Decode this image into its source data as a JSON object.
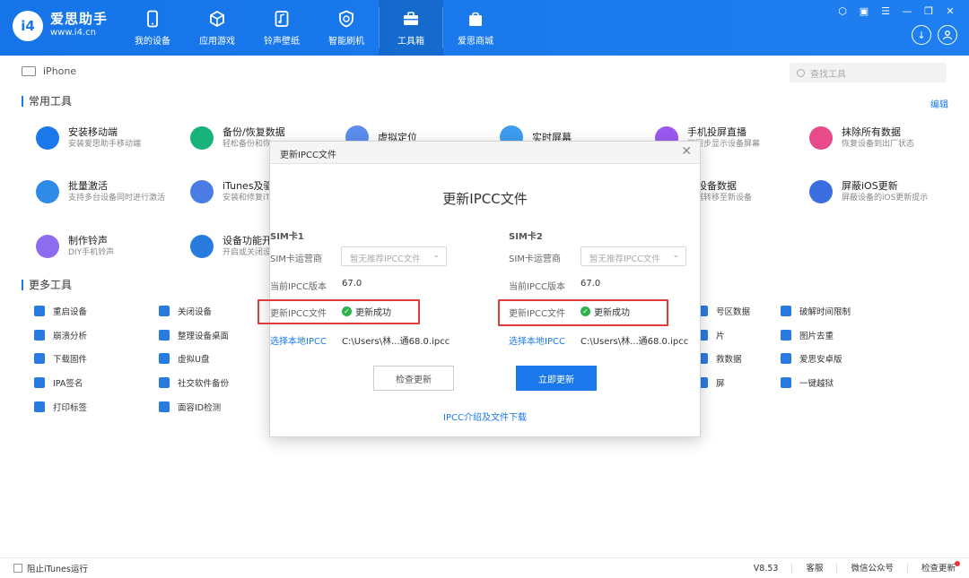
{
  "app": {
    "name": "爱思助手",
    "url": "www.i4.cn",
    "badge": "i4"
  },
  "nav": [
    {
      "label": "我的设备",
      "icon": "phone-icon"
    },
    {
      "label": "应用游戏",
      "icon": "cube-icon"
    },
    {
      "label": "铃声壁纸",
      "icon": "music-file-icon"
    },
    {
      "label": "智能刷机",
      "icon": "refresh-shield-icon"
    },
    {
      "label": "工具箱",
      "icon": "toolbox-icon",
      "active": true
    },
    {
      "label": "爱思商城",
      "icon": "shopping-bag-icon"
    }
  ],
  "device": {
    "name": "iPhone"
  },
  "search": {
    "placeholder": "查找工具"
  },
  "common": {
    "title": "常用工具",
    "edit": "编辑",
    "tools": [
      {
        "title": "安装移动端",
        "desc": "安装爱思助手移动端",
        "color": "#1a78ea",
        "icon": "i4-app-icon"
      },
      {
        "title": "备份/恢复数据",
        "desc": "轻松备份和恢",
        "color": "#18b37a",
        "icon": "layers-icon"
      },
      {
        "title": "虚拟定位",
        "desc": "",
        "color": "#5b8def",
        "icon": "location-pin-icon"
      },
      {
        "title": "实时屏幕",
        "desc": "",
        "color": "#3d9cf0",
        "icon": "screen-icon"
      },
      {
        "title": "手机投屏直播",
        "desc": "画同步显示设备屏幕",
        "color": "#9b59f0",
        "icon": "play-screen-icon"
      },
      {
        "title": "抹除所有数据",
        "desc": "恢复设备到出厂状态",
        "color": "#e84b8a",
        "icon": "eraser-icon"
      },
      {
        "title": "批量激活",
        "desc": "支持多台设备同时进行激活",
        "color": "#2f8be8",
        "icon": "batch-activate-icon"
      },
      {
        "title": "iTunes及驱",
        "desc": "安装和修复iT",
        "color": "#4a7ce6",
        "icon": "music-note-icon"
      },
      {
        "title": "移设备数据",
        "desc": "数据转移至新设备",
        "color": "#3a8ee6",
        "icon": "transfer-icon"
      },
      {
        "title": "屏蔽iOS更新",
        "desc": "屏蔽设备的iOS更新提示",
        "color": "#3b6fe0",
        "icon": "block-update-icon"
      },
      {
        "title": "制作铃声",
        "desc": "DIY手机铃声",
        "color": "#8e6cf0",
        "icon": "ringtone-icon"
      },
      {
        "title": "设备功能开",
        "desc": "开启或关闭设",
        "color": "#2a7be0",
        "icon": "sliders-icon"
      }
    ]
  },
  "more": {
    "title": "更多工具",
    "tools": [
      {
        "label": "重启设备",
        "icon": "restart-icon"
      },
      {
        "label": "关闭设备",
        "icon": "power-icon"
      },
      {
        "label": "号区数据",
        "icon": "data-icon"
      },
      {
        "label": "破解时间限制",
        "icon": "clock-icon"
      },
      {
        "label": "崩溃分析",
        "icon": "crash-analysis-icon"
      },
      {
        "label": "整理设备桌面",
        "icon": "grid-icon"
      },
      {
        "label": "片",
        "icon": "image-icon"
      },
      {
        "label": "图片去重",
        "icon": "image-dedupe-icon"
      },
      {
        "label": "下载固件",
        "icon": "download-firmware-icon"
      },
      {
        "label": "虚拟U盘",
        "icon": "usb-drive-icon"
      },
      {
        "label": "救数据",
        "icon": "rescue-data-icon"
      },
      {
        "label": "爱思安卓版",
        "icon": "android-icon"
      },
      {
        "label": "IPA签名",
        "icon": "ipa-icon"
      },
      {
        "label": "社交软件备份",
        "icon": "social-backup-icon"
      },
      {
        "label": "屏",
        "icon": "screen-icon"
      },
      {
        "label": "一键越狱",
        "icon": "lock-icon"
      },
      {
        "label": "打印标签",
        "icon": "printer-icon"
      },
      {
        "label": "面容ID检测",
        "icon": "face-id-icon"
      }
    ]
  },
  "modal": {
    "header": "更新IPCC文件",
    "title": "更新IPCC文件",
    "sim1": {
      "label": "SIM卡1",
      "carrier_label": "SIM卡运营商",
      "carrier_placeholder": "暂无推荐IPCC文件",
      "version_label": "当前IPCC版本",
      "version": "67.0",
      "file_label": "更新IPCC文件",
      "status": "更新成功",
      "choose_label": "选择本地IPCC",
      "path": "C:\\Users\\林...通68.0.ipcc"
    },
    "sim2": {
      "label": "SIM卡2",
      "carrier_label": "SIM卡运营商",
      "carrier_placeholder": "暂无推荐IPCC文件",
      "version_label": "当前IPCC版本",
      "version": "67.0",
      "file_label": "更新IPCC文件",
      "status": "更新成功",
      "choose_label": "选择本地IPCC",
      "path": "C:\\Users\\林...通68.0.ipcc"
    },
    "check_button": "检查更新",
    "update_button": "立即更新",
    "intro_link": "IPCC介绍及文件下载"
  },
  "bottom": {
    "block_itunes": "阻止iTunes运行",
    "version": "V8.53",
    "service": "客服",
    "wechat": "微信公众号",
    "check_update": "检查更新"
  },
  "colors": {
    "brand": "#1a78ea",
    "success": "#2cb34a",
    "highlight": "#e03b3b"
  }
}
